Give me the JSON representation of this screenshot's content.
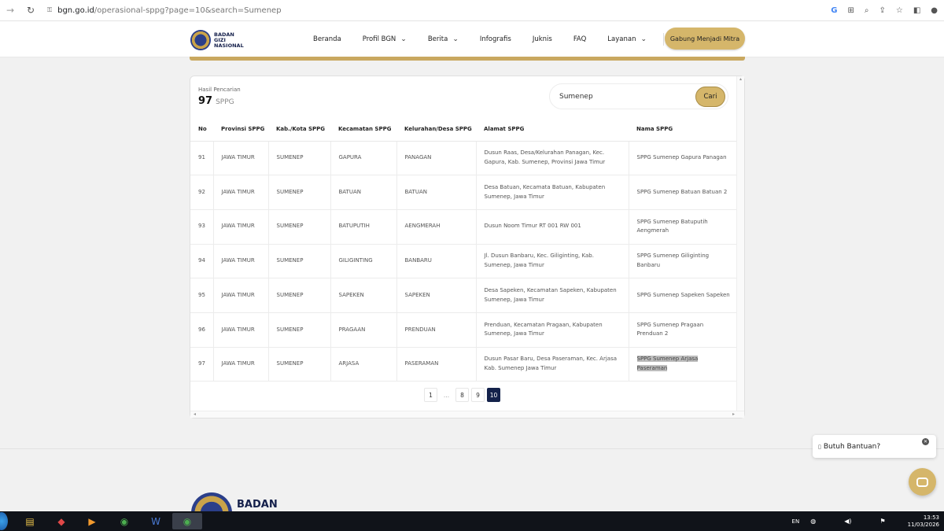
{
  "browser": {
    "url_domain": "bgn.go.id",
    "url_path": "/operasional-sppg?page=10&search=Sumenep"
  },
  "site": {
    "logo_lines": [
      "BADAN",
      "GIZI",
      "NASIONAL"
    ],
    "menu": [
      {
        "label": "Beranda",
        "dropdown": false
      },
      {
        "label": "Profil BGN",
        "dropdown": true
      },
      {
        "label": "Berita",
        "dropdown": true
      },
      {
        "label": "Infografis",
        "dropdown": false
      },
      {
        "label": "Juknis",
        "dropdown": false
      },
      {
        "label": "FAQ",
        "dropdown": false
      },
      {
        "label": "Layanan",
        "dropdown": true
      }
    ],
    "cta_label": "Gabung Menjadi Mitra"
  },
  "results": {
    "label": "Hasil Pencarian",
    "count": "97",
    "unit": "SPPG"
  },
  "search": {
    "value": "Sumenep",
    "button_label": "Cari"
  },
  "table": {
    "columns": [
      "No",
      "Provinsi SPPG",
      "Kab./Kota SPPG",
      "Kecamatan SPPG",
      "Kelurahan/Desa SPPG",
      "Alamat SPPG",
      "Nama SPPG"
    ],
    "rows": [
      [
        "91",
        "JAWA TIMUR",
        "SUMENEP",
        "GAPURA",
        "PANAGAN",
        "Dusun Raas, Desa/Kelurahan Panagan, Kec. Gapura, Kab. Sumenep, Provinsi Jawa Timur",
        "SPPG Sumenep Gapura Panagan"
      ],
      [
        "92",
        "JAWA TIMUR",
        "SUMENEP",
        "BATUAN",
        "BATUAN",
        "Desa Batuan, Kecamata Batuan, Kabupaten Sumenep, Jawa Timur",
        "SPPG Sumenep Batuan Batuan 2"
      ],
      [
        "93",
        "JAWA TIMUR",
        "SUMENEP",
        "BATUPUTIH",
        "AENGMERAH",
        "Dusun Noom Timur RT 001 RW 001",
        "SPPG Sumenep Batuputih Aengmerah"
      ],
      [
        "94",
        "JAWA TIMUR",
        "SUMENEP",
        "GILIGINTING",
        "BANBARU",
        "Jl. Dusun Banbaru, Kec. Giliginting, Kab. Sumenep, Jawa Timur",
        "SPPG Sumenep Giliginting Banbaru"
      ],
      [
        "95",
        "JAWA TIMUR",
        "SUMENEP",
        "SAPEKEN",
        "SAPEKEN",
        "Desa Sapeken, Kecamatan Sapeken, Kabupaten Sumenep, Jawa Timur",
        "SPPG Sumenep Sapeken Sapeken"
      ],
      [
        "96",
        "JAWA TIMUR",
        "SUMENEP",
        "PRAGAAN",
        "PRENDUAN",
        "Prenduan, Kecamatan Pragaan, Kabupaten Sumenep, Jawa Timur",
        "SPPG Sumenep Pragaan Prenduan 2"
      ],
      [
        "97",
        "JAWA TIMUR",
        "SUMENEP",
        "ARJASA",
        "PASERAMAN",
        "Dusun Pasar Baru, Desa Paseraman, Kec. Arjasa Kab. Sumenep Jawa Timur",
        "SPPG Sumenep Arjasa Paseraman"
      ]
    ]
  },
  "pagination": {
    "items": [
      "1",
      "...",
      "8",
      "9",
      "10"
    ],
    "active": "10"
  },
  "footer": {
    "logo_text": "BADAN"
  },
  "help": {
    "label": "Butuh Bantuan?"
  },
  "taskbar": {
    "language": "EN",
    "time": "13:53",
    "date": "11/03/2026"
  },
  "colors": {
    "gold": "#d5b66a",
    "navy": "#14224b"
  }
}
